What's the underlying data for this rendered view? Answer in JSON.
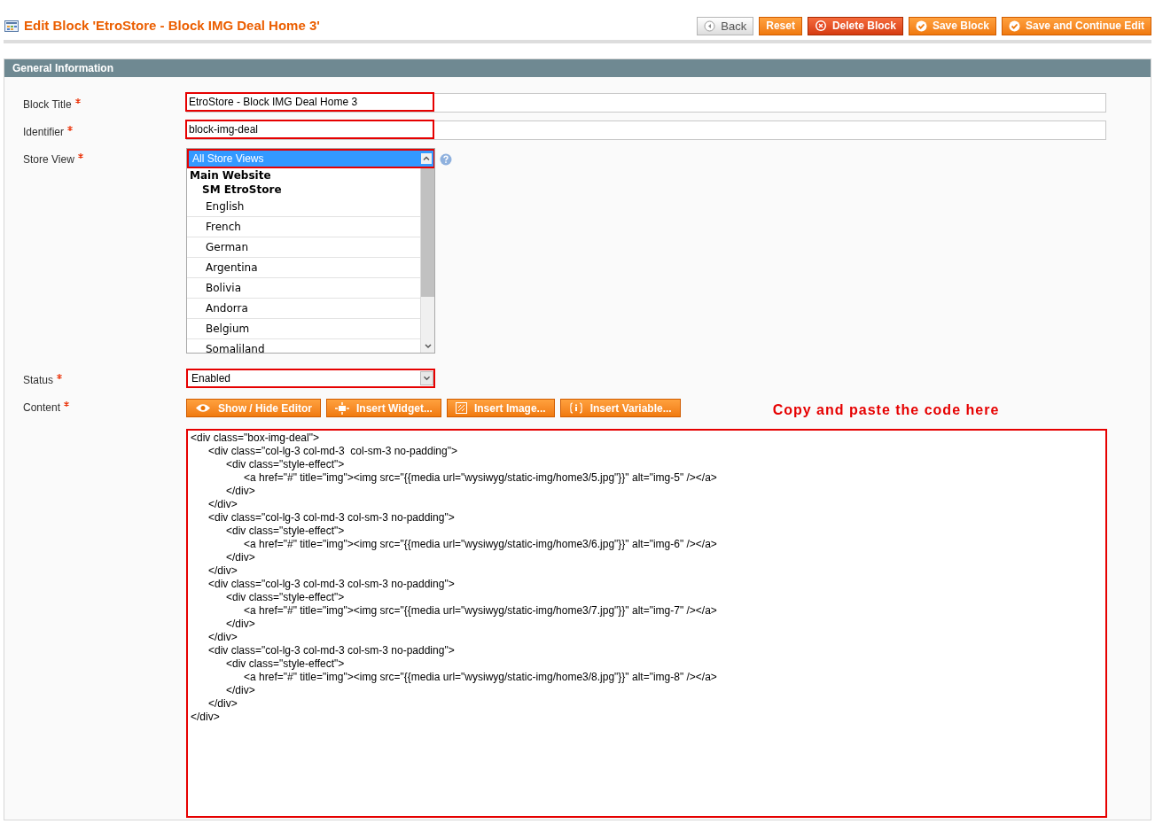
{
  "page": {
    "title": "Edit Block 'EtroStore - Block IMG Deal Home 3'"
  },
  "buttons": [
    {
      "label": "Back",
      "kind": "back"
    },
    {
      "label": "Reset",
      "kind": "reset"
    },
    {
      "label": "Delete Block",
      "kind": "delete"
    },
    {
      "label": "Save Block",
      "kind": "save"
    },
    {
      "label": "Save and Continue Edit",
      "kind": "save"
    }
  ],
  "section": {
    "title": "General Information"
  },
  "fields": {
    "block_title": {
      "label": "Block Title",
      "required": true,
      "value": "EtroStore - Block IMG Deal Home 3"
    },
    "identifier": {
      "label": "Identifier",
      "required": true,
      "value": "block-img-deal"
    },
    "store_view": {
      "label": "Store View",
      "required": true,
      "options": [
        {
          "label": "All Store Views",
          "selected": true
        },
        {
          "label": "Main Website",
          "kind": "group",
          "children": [
            {
              "label": "SM EtroStore",
              "kind": "group",
              "children": [
                {
                  "label": "English",
                  "selected": false
                },
                {
                  "label": "French",
                  "selected": false
                },
                {
                  "label": "German",
                  "selected": false
                },
                {
                  "label": "Argentina",
                  "selected": false
                },
                {
                  "label": "Bolivia",
                  "selected": false
                },
                {
                  "label": "Andorra",
                  "selected": false
                },
                {
                  "label": "Belgium",
                  "selected": false
                },
                {
                  "label": "Somaliland",
                  "selected": false
                }
              ]
            }
          ]
        }
      ]
    },
    "status": {
      "label": "Status",
      "required": true,
      "value": "Enabled"
    },
    "content": {
      "label": "Content",
      "required": true,
      "buttons": [
        {
          "label": "Show / Hide Editor",
          "kind": "editor"
        },
        {
          "label": "Insert Widget...",
          "kind": "widget"
        },
        {
          "label": "Insert Image...",
          "kind": "image"
        },
        {
          "label": "Insert Variable...",
          "kind": "variable"
        }
      ],
      "value": "<div class=\"box-img-deal\">\n\t<div class=\"col-lg-3 col-md-3  col-sm-3 no-padding\">\n\t\t<div class=\"style-effect\">\n\t\t\t<a href=\"#\" title=\"img\"><img src=\"{{media url=\"wysiwyg/static-img/home3/5.jpg\"}}\" alt=\"img-5\" /></a>\n\t\t</div>\n\t</div>\n\t<div class=\"col-lg-3 col-md-3 col-sm-3 no-padding\">\n\t\t<div class=\"style-effect\">\n\t\t\t<a href=\"#\" title=\"img\"><img src=\"{{media url=\"wysiwyg/static-img/home3/6.jpg\"}}\" alt=\"img-6\" /></a>\n\t\t</div>\n\t</div>\n\t<div class=\"col-lg-3 col-md-3 col-sm-3 no-padding\">\n\t\t<div class=\"style-effect\">\n\t\t\t<a href=\"#\" title=\"img\"><img src=\"{{media url=\"wysiwyg/static-img/home3/7.jpg\"}}\" alt=\"img-7\" /></a>\n\t\t</div>\n\t</div>\n\t<div class=\"col-lg-3 col-md-3 col-sm-3 no-padding\">\n\t\t<div class=\"style-effect\">\n\t\t\t<a href=\"#\" title=\"img\"><img src=\"{{media url=\"wysiwyg/static-img/home3/8.jpg\"}}\" alt=\"img-8\" /></a>\n\t\t</div>\n\t</div>\n</div>"
    }
  },
  "annotation": "Copy and paste the code here"
}
